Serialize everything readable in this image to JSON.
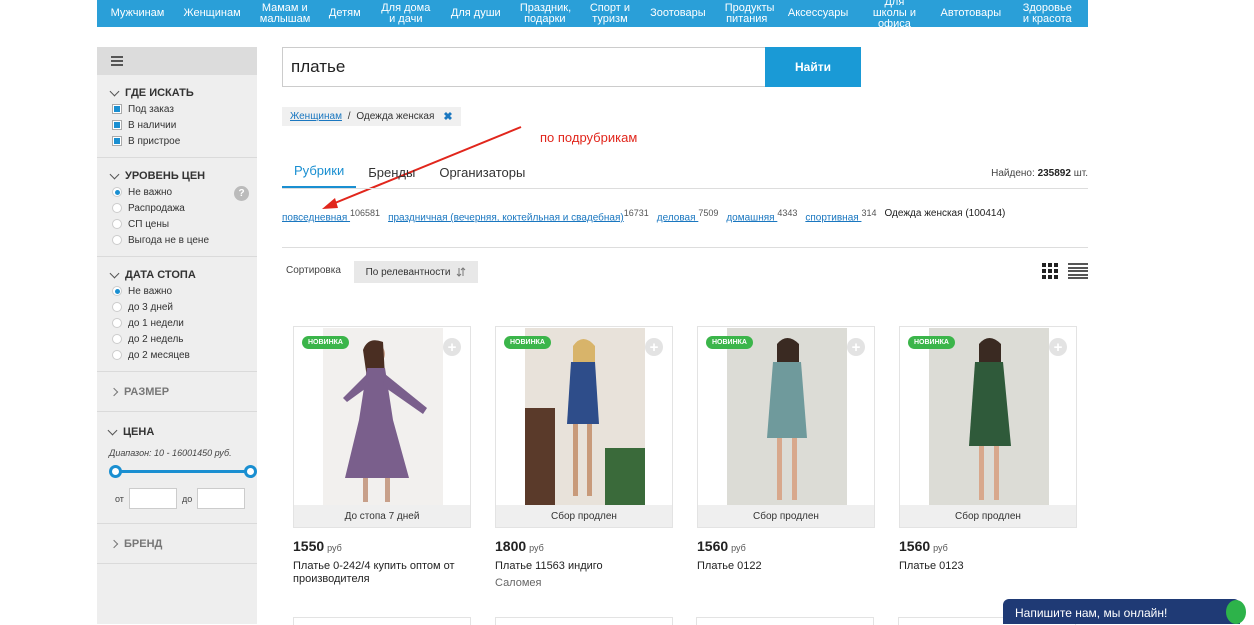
{
  "topnav": [
    "Мужчинам",
    "Женщинам",
    "Мамам и малышам",
    "Детям",
    "Для дома и дачи",
    "Для души",
    "Праздник, подарки",
    "Спорт и туризм",
    "Зоотовары",
    "Продукты питания",
    "Аксессуары",
    "Для школы и офиса",
    "Автотовары",
    "Здоровье и красота"
  ],
  "sidebar": {
    "where": {
      "title": "ГДЕ ИСКАТЬ",
      "options": [
        "Под заказ",
        "В наличии",
        "В пристрое"
      ]
    },
    "price_level": {
      "title": "УРОВЕНЬ ЦЕН",
      "help": "?",
      "options": [
        "Не важно",
        "Распродажа",
        "СП цены",
        "Выгода не в цене"
      ],
      "selected": 0
    },
    "stop_date": {
      "title": "ДАТА СТОПА",
      "options": [
        "Не важно",
        "до 3 дней",
        "до 1 недели",
        "до 2 недель",
        "до 2 месяцев"
      ],
      "selected": 0
    },
    "size": {
      "title": "РАЗМЕР"
    },
    "price": {
      "title": "ЦЕНА",
      "range_note": "Диапазон: 10 - 16001450 руб.",
      "from_label": "от",
      "to_label": "до"
    },
    "brand": {
      "title": "БРЕНД"
    }
  },
  "search": {
    "value": "платье",
    "button": "Найти"
  },
  "breadcrumb": {
    "link": "Женщинам",
    "separator": " / ",
    "current": "Одежда женская",
    "remove": "✖"
  },
  "annotation": "по подрубрикам",
  "tabs": [
    "Рубрики",
    "Бренды",
    "Организаторы"
  ],
  "found": {
    "label": "Найдено:",
    "count": "235892",
    "unit": "шт."
  },
  "subcategories": [
    {
      "label": "повседневная ",
      "count": "106581"
    },
    {
      "label": "праздничная (вечерняя, коктейльная и свадебная)",
      "count": "16731"
    },
    {
      "label": "деловая ",
      "count": "7509"
    },
    {
      "label": "домашняя ",
      "count": "4343"
    },
    {
      "label": "спортивная ",
      "count": "314"
    }
  ],
  "current_category": "Одежда женская (100414)",
  "sort": {
    "label": "Сортировка",
    "value": "По релевантности"
  },
  "products": [
    {
      "badge": "НОВИНКА",
      "caption": "До стопа 7 дней",
      "price": "1550",
      "currency": "руб",
      "name": "Платье 0-242/4 купить оптом от производителя",
      "org": "",
      "dress": "#7a5f8c"
    },
    {
      "badge": "НОВИНКА",
      "caption": "Сбор продлен",
      "price": "1800",
      "currency": "руб",
      "name": "Платье 11563 индиго",
      "org": "Саломея",
      "dress": "#2e4d8a"
    },
    {
      "badge": "НОВИНКА",
      "caption": "Сбор продлен",
      "price": "1560",
      "currency": "руб",
      "name": "Платье 0122",
      "org": "",
      "dress": "#6f9a9c"
    },
    {
      "badge": "НОВИНКА",
      "caption": "Сбор продлен",
      "price": "1560",
      "currency": "руб",
      "name": "Платье 0123",
      "org": "",
      "dress": "#2f5a3a"
    }
  ],
  "chat": "Напишите нам, мы онлайн!",
  "colors": {
    "accent": "#1a9ad6",
    "badge": "#3bb54a",
    "annotation": "#e1261c",
    "chat": "#1f3a75"
  }
}
